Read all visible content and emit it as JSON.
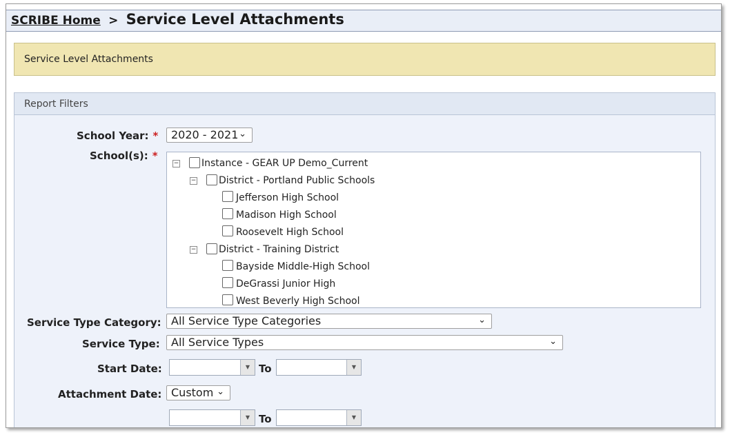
{
  "header": {
    "home_link": "SCRIBE Home",
    "separator": ">",
    "page_title": "Service Level Attachments"
  },
  "banner": {
    "text": "Service Level Attachments"
  },
  "filters": {
    "panel_title": "Report Filters",
    "school_year": {
      "label": "School Year:",
      "value": "2020 - 2021",
      "required": "*"
    },
    "schools": {
      "label": "School(s):",
      "required": "*",
      "tree": [
        {
          "text": "Instance - GEAR UP Demo_Current",
          "expander": "−"
        },
        {
          "text": "District - Portland Public Schools",
          "expander": "−"
        },
        {
          "text": "Jefferson High School"
        },
        {
          "text": "Madison High School"
        },
        {
          "text": "Roosevelt High School"
        },
        {
          "text": "District - Training District",
          "expander": "−"
        },
        {
          "text": "Bayside Middle-High School"
        },
        {
          "text": "DeGrassi Junior High"
        },
        {
          "text": "West Beverly High School"
        }
      ]
    },
    "service_type_category": {
      "label": "Service Type Category:",
      "value": "All Service Type Categories"
    },
    "service_type": {
      "label": "Service Type:",
      "value": "All Service Types"
    },
    "start_date": {
      "label": "Start Date:",
      "to_label": "To",
      "from_value": "",
      "to_value": ""
    },
    "attachment_date": {
      "label": "Attachment Date:",
      "value": "Custom",
      "to_label": "To",
      "from_value": "",
      "to_value": ""
    }
  },
  "icons": {
    "dropdown": "chevron-down-icon",
    "calendar_dropdown": "triangle-down-icon",
    "collapse": "minus-box-icon",
    "checkbox": "checkbox-icon"
  }
}
